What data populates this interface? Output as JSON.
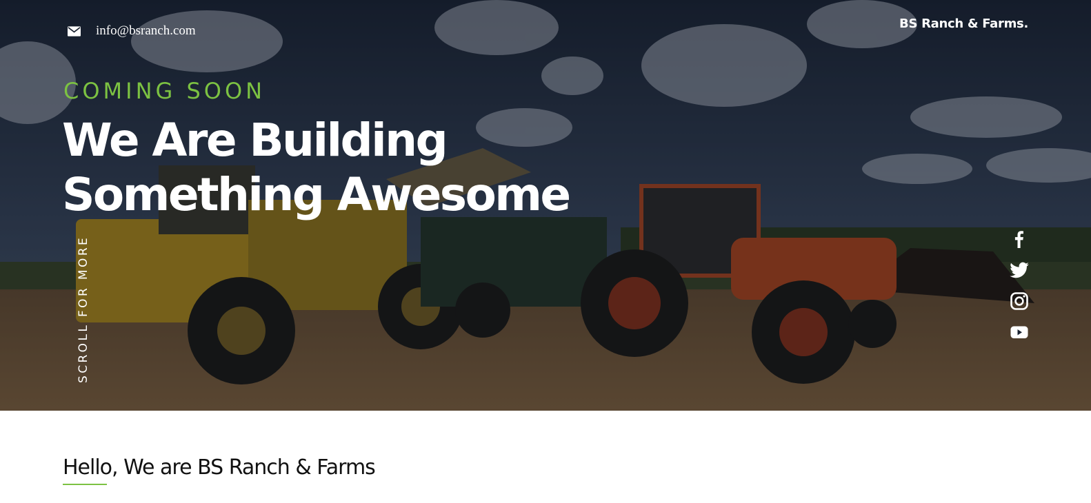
{
  "header": {
    "email": "info@bsranch.com",
    "brand": "BS Ranch & Farms."
  },
  "hero": {
    "eyebrow": "COMING SOON",
    "headline_line1": "We Are Building",
    "headline_line2": "Something Awesome",
    "scroll_label": "SCROLL FOR MORE"
  },
  "social": {
    "icons": [
      "facebook-icon",
      "twitter-icon",
      "instagram-icon",
      "youtube-icon"
    ]
  },
  "about": {
    "title": "Hello, We are BS Ranch & Farms"
  },
  "colors": {
    "accent": "#7cc242",
    "text_on_dark": "#ffffff",
    "heading_dark": "#111111"
  }
}
